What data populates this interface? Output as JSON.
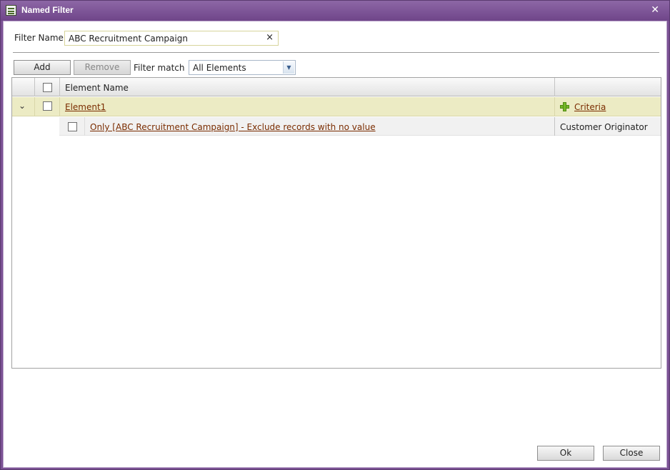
{
  "window": {
    "title": "Named Filter",
    "close_glyph": "✕",
    "icon": "filter-list-icon"
  },
  "form": {
    "filter_name_label": "Filter Name",
    "filter_name_value": "ABC Recruitment Campaign",
    "clear_glyph": "×"
  },
  "toolbar": {
    "add_label": "Add",
    "remove_label": "Remove",
    "filter_match_label": "Filter match",
    "filter_match_value": "All Elements",
    "dropdown_glyph": "▼"
  },
  "grid": {
    "header": {
      "element_name": "Element Name"
    },
    "expand_glyph": "⌄",
    "element": {
      "name": "Element1",
      "criteria_label": "Criteria",
      "criteria_icon": "plus-icon"
    },
    "criteria_row": {
      "description": "Only [ABC Recruitment Campaign] - Exclude records with no value",
      "field": "Customer Originator"
    }
  },
  "footer": {
    "ok_label": "Ok",
    "close_label": "Close"
  },
  "colors": {
    "window_frame": "#7b5294",
    "selected_row": "#ecebc4",
    "link": "#7a2c00",
    "plus_icon": "#77b82a"
  }
}
